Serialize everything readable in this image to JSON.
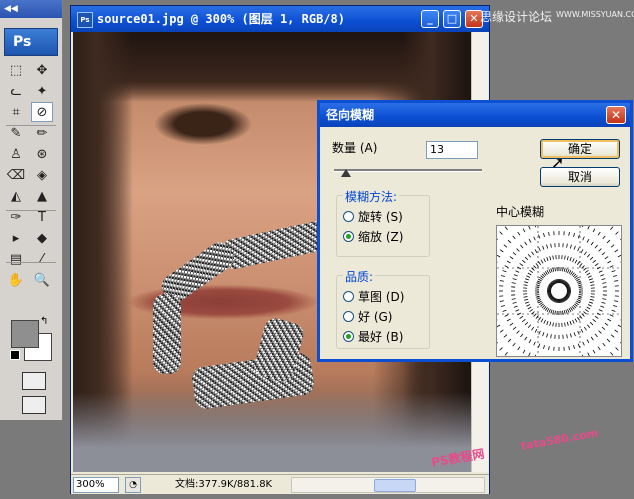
{
  "toolbox": {
    "grip_label": "◀◀",
    "logo": "Ps",
    "tools": [
      "⬚",
      "✥",
      "ᓚ",
      "✦",
      "⌗",
      "⊘",
      "✎",
      "✏",
      "♙",
      "⊛",
      "⌫",
      "◈",
      "◭",
      "▲",
      "✑",
      "T",
      "▸",
      "◆",
      "▤",
      "⁄",
      "✋",
      "🔍"
    ]
  },
  "document": {
    "icon_label": "Ps",
    "title": "source01.jpg @ 300% (图层 1, RGB/8)",
    "minimize": "_",
    "maximize": "□",
    "close": "✕",
    "zoom": "300%",
    "doc_size": "文档:377.9K/881.8K"
  },
  "dialog": {
    "title": "径向模糊",
    "close": "✕",
    "amount_label": "数量 (A)",
    "amount_value": "13",
    "amount_slider_fraction": 0.08,
    "ok_label": "确定",
    "cancel_label": "取消",
    "method_group": {
      "title": "模糊方法:",
      "options": [
        {
          "label": "旋转 (S)",
          "checked": false
        },
        {
          "label": "缩放 (Z)",
          "checked": true
        }
      ]
    },
    "quality_group": {
      "title": "品质:",
      "options": [
        {
          "label": "草图 (D)",
          "checked": false
        },
        {
          "label": "好 (G)",
          "checked": false
        },
        {
          "label": "最好 (B)",
          "checked": true
        }
      ]
    },
    "center_label": "中心模糊"
  },
  "watermarks": {
    "top": "思缘设计论坛",
    "top_url": "WWW.MISSYUAN.COM",
    "bottom_cn": "PS教程网",
    "bottom_url": "tata580.com"
  }
}
